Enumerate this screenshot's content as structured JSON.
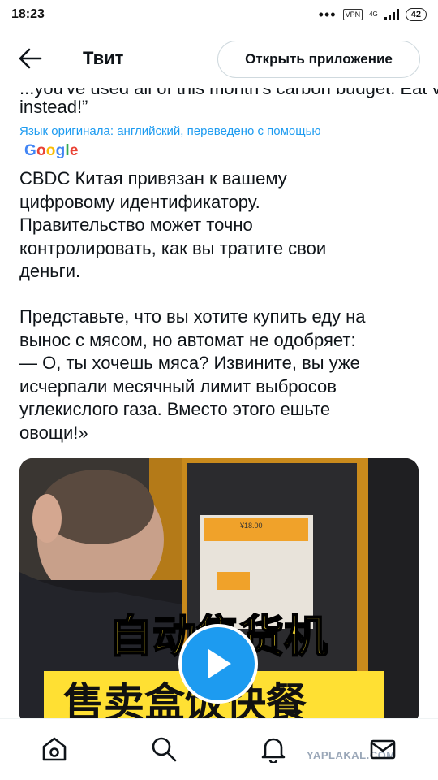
{
  "status_bar": {
    "time": "18:23",
    "dots": "•••",
    "vpn": "VPN",
    "network": "4G",
    "battery": "42"
  },
  "header": {
    "title": "Твит",
    "open_app_label": "Открыть приложение"
  },
  "tweet": {
    "cut_english_line": "...you've used all of this month's carbon budget. Eat veggies",
    "english_tail": "instead!”",
    "translation_note": "Язык оригинала: английский, переведено с помощью",
    "translator_logo": [
      "G",
      "o",
      "o",
      "g",
      "l",
      "e"
    ],
    "paragraph1": "CBDC Китая привязан к вашему\nцифровому идентификатору.\nПравительство может точно\nконтролировать, как вы тратите свои\nденьги.",
    "paragraph2": "Представьте, что вы хотите купить еду на\nвынос с мясом, но автомат не одобряет:\n— О, ты хочешь мяса? Извините, вы уже\nисчерпали месячный лимит выбросов\nуглекислого газа. Вместо этого ешьте\nовощи!»"
  },
  "video": {
    "price": "¥18.00",
    "caption_line1": "自动售货机",
    "caption_line2": "售卖盒饭快餐",
    "colors": {
      "caption_yellow": "#ffe033",
      "play_blue": "#1d9bf0"
    }
  },
  "bottom_nav": {
    "items": [
      "home-icon",
      "search-icon",
      "notifications-icon",
      "messages-icon"
    ],
    "watermark": "YAPLAKAL.COM"
  }
}
